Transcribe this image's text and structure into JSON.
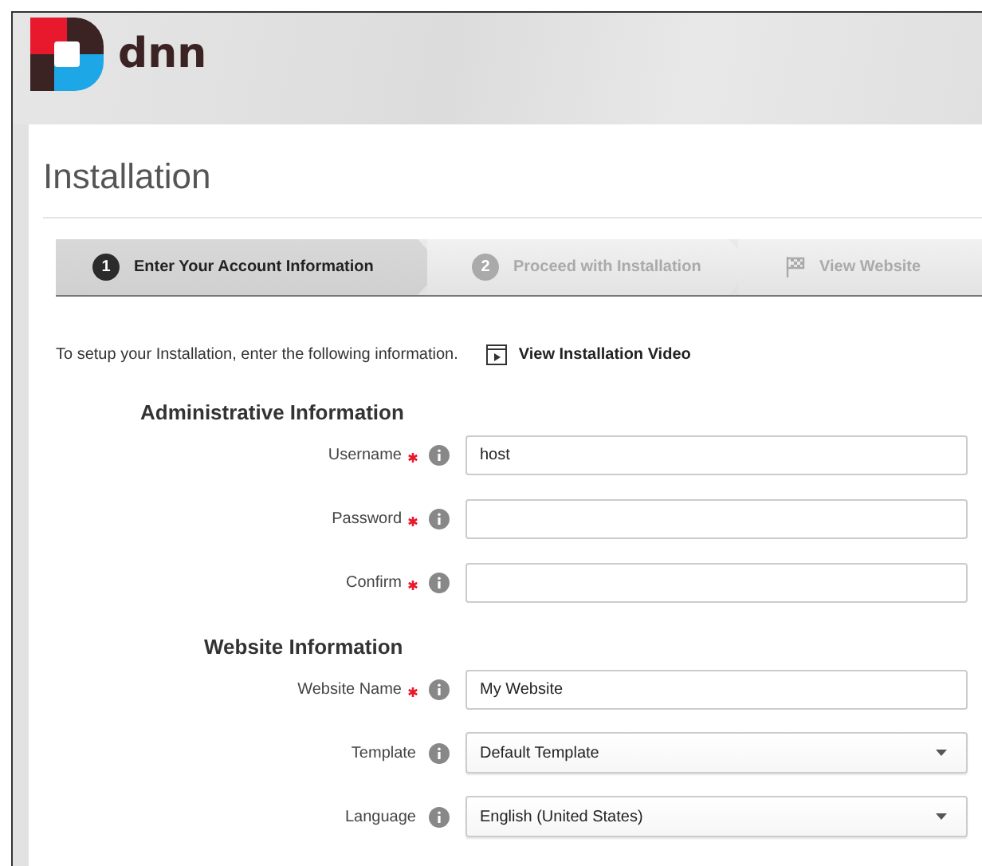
{
  "header": {
    "logo_text": "dnn"
  },
  "title": "Installation",
  "steps": [
    {
      "kind": "numbered",
      "number": "1",
      "label": "Enter Your Account Information",
      "selected": true
    },
    {
      "kind": "numbered",
      "number": "2",
      "label": "Proceed with Installation",
      "selected": false
    },
    {
      "kind": "flag",
      "label": "View Website",
      "selected": false
    }
  ],
  "intro": {
    "text": "To setup your Installation, enter the following information.",
    "video_link": "View Installation Video"
  },
  "sections": [
    {
      "heading": "Administrative Information",
      "fields": [
        {
          "kind": "text",
          "label": "Username",
          "required": true,
          "value": "host"
        },
        {
          "kind": "text",
          "label": "Password",
          "required": true
        },
        {
          "kind": "text",
          "label": "Confirm",
          "required": true
        }
      ]
    },
    {
      "heading": "Website Information",
      "fields": [
        {
          "kind": "text",
          "label": "Website Name",
          "required": true,
          "value": "My Website"
        },
        {
          "kind": "select",
          "label": "Template",
          "required": false,
          "value": "Default Template"
        },
        {
          "kind": "select",
          "label": "Language",
          "required": false,
          "value": "English (United States)"
        }
      ]
    }
  ]
}
